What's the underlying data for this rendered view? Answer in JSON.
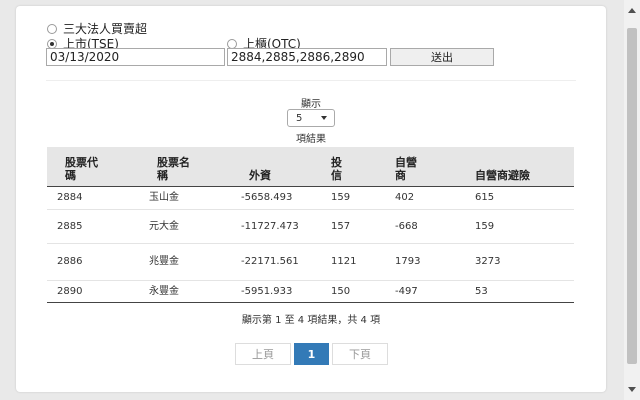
{
  "form": {
    "option_institutional": "三大法人買賣超",
    "option_tse": "上市(TSE)",
    "option_otc": "上櫃(OTC)",
    "date_value": "03/13/2020",
    "codes_value": "2884,2885,2886,2890",
    "submit_label": "送出",
    "selected_market": "tse"
  },
  "page_size": {
    "show_label": "顯示",
    "selected": "5",
    "results_label": "項結果"
  },
  "table": {
    "headers": [
      "股票代碼",
      "股票名稱",
      "外資",
      "投信",
      "自營商",
      "自營商避險"
    ],
    "rows": [
      [
        "2884",
        "玉山金",
        "-5658.493",
        "159",
        "402",
        "615"
      ],
      [
        "2885",
        "元大金",
        "-11727.473",
        "157",
        "-668",
        "159"
      ],
      [
        "2886",
        "兆豐金",
        "-22171.561",
        "1121",
        "1793",
        "3273"
      ],
      [
        "2890",
        "永豐金",
        "-5951.933",
        "150",
        "-497",
        "53"
      ]
    ]
  },
  "info": "顯示第 1 至 4 項結果，共 4 項",
  "pagination": {
    "prev_label": "上頁",
    "current_page": "1",
    "next_label": "下頁"
  }
}
